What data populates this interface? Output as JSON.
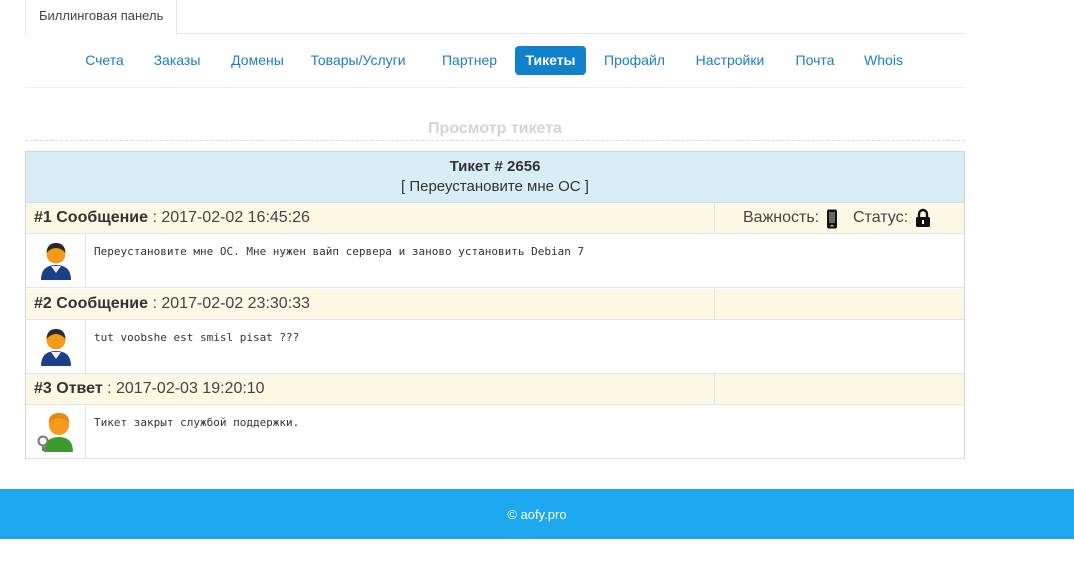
{
  "panel": {
    "tab_label": "Биллинговая панель"
  },
  "nav": {
    "items": [
      {
        "label": "Счета",
        "active": false
      },
      {
        "label": "Заказы",
        "active": false
      },
      {
        "label": "Домены",
        "active": false
      },
      {
        "label": "Товары/Услуги",
        "active": false
      },
      {
        "label": "Партнер",
        "active": false
      },
      {
        "label": "Тикеты",
        "active": true
      },
      {
        "label": "Профайл",
        "active": false
      },
      {
        "label": "Настройки",
        "active": false
      },
      {
        "label": "Почта",
        "active": false
      },
      {
        "label": "Whois",
        "active": false
      }
    ]
  },
  "page": {
    "title": "Просмотр тикета"
  },
  "ticket": {
    "number": "Тикет # 2656",
    "subject": "[ Переустановите мне ОС ]",
    "importance_label": "Важность:",
    "importance_icon": "phone-icon",
    "status_label": "Статус:",
    "status_icon": "lock-icon",
    "messages": [
      {
        "label": "#1 Сообщение",
        "datetime": " : 2017-02-02 16:45:26",
        "text": "Переустановите мне ОС. Мне нужен вайп сервера и заново установить Debian 7",
        "avatar": "user-avatar-icon"
      },
      {
        "label": "#2 Сообщение",
        "datetime": " : 2017-02-02 23:30:33",
        "text": "tut voobshe est smisl pisat ???",
        "avatar": "user-avatar-icon"
      },
      {
        "label": "#3 Ответ",
        "datetime": " : 2017-02-03 19:20:10",
        "text": "Тикет закрыт службой поддержки.",
        "avatar": "support-avatar-icon"
      }
    ]
  },
  "footer": {
    "text": "© aofy.pro"
  },
  "colors": {
    "accent": "#1181cc",
    "link": "#1a7fc0",
    "header_bg": "#d9edf7",
    "msg_head_bg": "#fbf8e3",
    "footer_bg": "#1da7ee"
  }
}
